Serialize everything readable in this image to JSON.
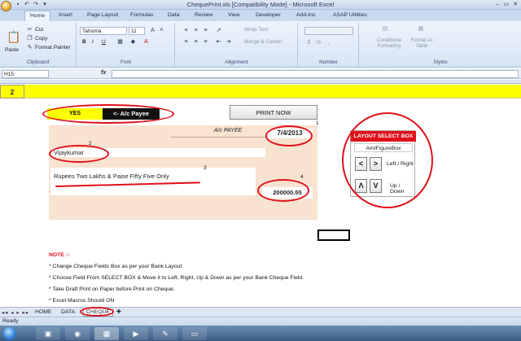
{
  "window": {
    "title": "ChequePrint.xls  [Compatibility Mode] - Microsoft Excel",
    "controls": [
      "–",
      "▭",
      "✕"
    ]
  },
  "ribbon": {
    "tabs": [
      "Home",
      "Insert",
      "Page Layout",
      "Formulas",
      "Data",
      "Review",
      "View",
      "Developer",
      "Add-Ins",
      "ASAP Utilities"
    ],
    "active_tab": "Home",
    "clipboard": {
      "paste": "Paste",
      "cut": "Cut",
      "copy": "Copy",
      "format_painter": "Format Painter",
      "label": "Clipboard"
    },
    "font": {
      "name": "Tahoma",
      "size": "11",
      "bold": "B",
      "italic": "I",
      "underline": "U",
      "label": "Font"
    },
    "alignment": {
      "wrap_text": "Wrap Text",
      "merge_center": "Merge & Center",
      "label": "Alignment"
    },
    "number": {
      "label": "Number"
    },
    "styles": {
      "conditional": "Conditional Formatting",
      "format_table": "Format as Table",
      "label": "Styles"
    }
  },
  "formula_bar": {
    "name_box": "H15",
    "fx": "fx",
    "formula": ""
  },
  "sheet": {
    "row_number": "2",
    "payee_toggle": "YES",
    "payee_label": "<- A/c Payee",
    "print_button": "PRINT NOW",
    "cheque": {
      "ac_payee": "A/c PAYEE",
      "date": "7/4/2013",
      "payee_name": "Vijaykumar",
      "amount_words": "Rupees Two Lakhs & Paise Fifty Five Only",
      "amount_figure": "200000.55"
    },
    "annotations": [
      "1",
      "2",
      "3",
      "4"
    ],
    "layout_box": {
      "title": "LAYOUT SELECT BOX",
      "selected_field": "AmtFigureBox",
      "left": "<",
      "right": ">",
      "left_right_label": "Left / Right",
      "up": "Λ",
      "down": "V",
      "up_down_label": "Up / Down"
    },
    "notes": {
      "heading": "NOTE :-",
      "items": [
        "* Change Cheque Fields Box as per your Bank Layout.",
        "* Choose Field From SELECT BOX & Move it to Left, Right, Up & Down as per your Bank Cheque Field.",
        "* Take Draft Print on Paper before Print on Cheque.",
        "* Excel Macros Should ON"
      ]
    }
  },
  "sheet_tabs": [
    "HOME",
    "DATA",
    "CHEQUE"
  ],
  "active_sheet": "CHEQUE",
  "status": "Ready",
  "colors": {
    "accent_red": "#e0101a",
    "yellow": "#ffff00",
    "cheque_bg": "#f8e2d0"
  }
}
